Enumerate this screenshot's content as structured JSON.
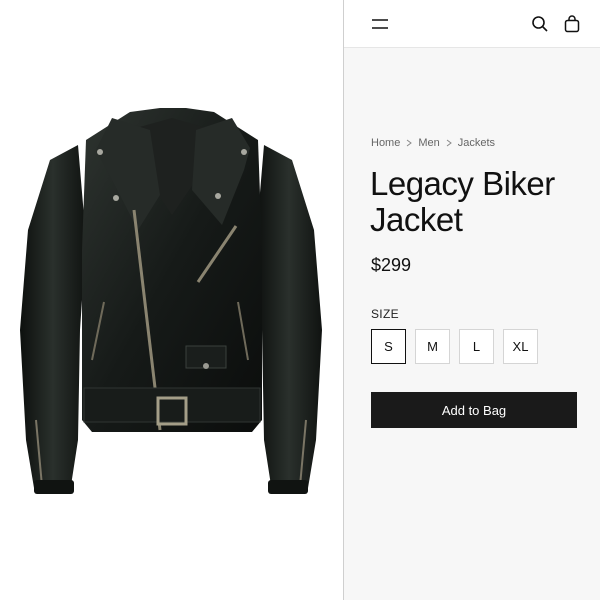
{
  "product_image": {
    "alt": "Legacy Biker Jacket"
  },
  "header": {
    "menu_icon": "hamburger-menu-icon",
    "search_icon": "search-icon",
    "bag_icon": "shopping-bag-icon"
  },
  "breadcrumb": [
    "Home",
    "Men",
    "Jackets"
  ],
  "product": {
    "title_line1": "Legacy Biker",
    "title_line2": "Jacket",
    "price": "$299"
  },
  "size": {
    "label": "SIZE",
    "options": [
      "S",
      "M",
      "L",
      "XL"
    ],
    "selected": "S"
  },
  "cta": {
    "add_to_bag": "Add to Bag"
  },
  "colors": {
    "button_bg": "#1a1a1a",
    "panel_bg": "#f7f7f7"
  }
}
